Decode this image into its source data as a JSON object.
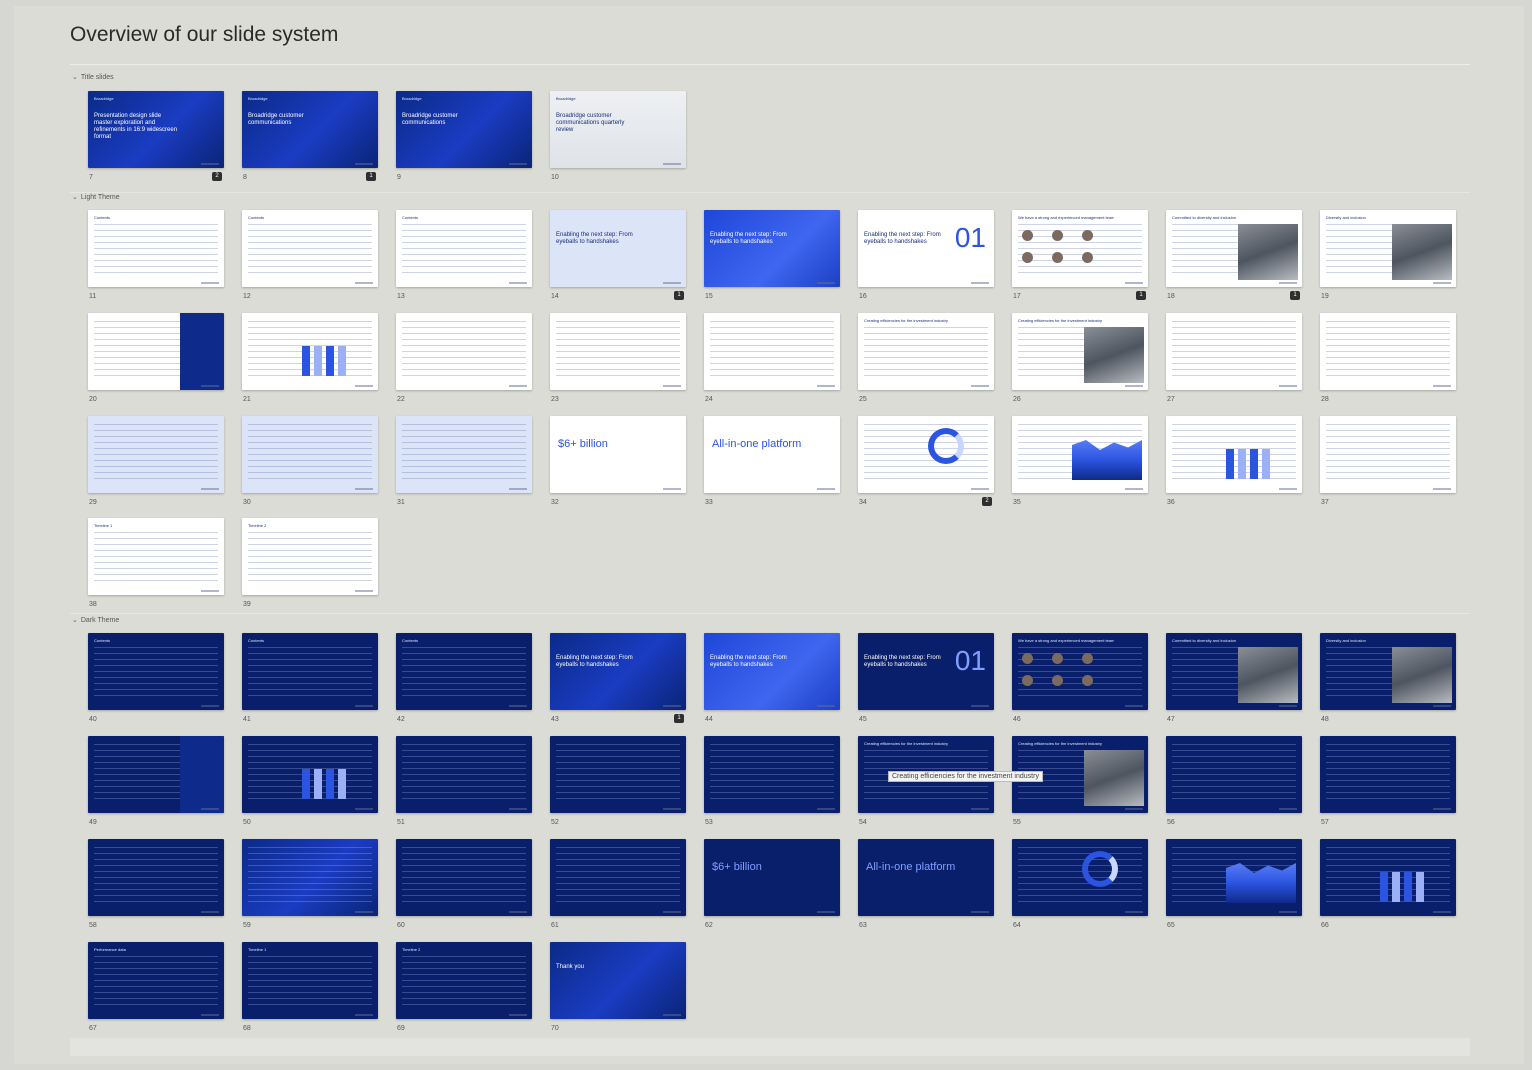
{
  "page": {
    "title": "Overview of our slide system"
  },
  "sections": [
    {
      "label": "Title slides"
    },
    {
      "label": "Light Theme"
    },
    {
      "label": "Dark Theme"
    }
  ],
  "slides": [
    {
      "num": "7",
      "head": "Broadridge",
      "title": "Presentation design slide master exploration and refinements in 16:9 widescreen format",
      "style": "blue",
      "comment": "2"
    },
    {
      "num": "8",
      "head": "Broadridge",
      "title": "Broadridge customer communications",
      "style": "blue",
      "comment": "1"
    },
    {
      "num": "9",
      "head": "Broadridge",
      "title": "Broadridge customer communications",
      "style": "blue"
    },
    {
      "num": "10",
      "head": "Broadridge",
      "title": "Broadridge customer communications quarterly review",
      "style": "photo"
    },
    {
      "num": "11",
      "head": "Contents",
      "style": "light"
    },
    {
      "num": "12",
      "head": "Contents",
      "style": "light"
    },
    {
      "num": "13",
      "head": "Contents",
      "style": "light"
    },
    {
      "num": "14",
      "title": "Enabling the next step: From eyeballs to handshakes",
      "style": "lightblue",
      "comment": "1"
    },
    {
      "num": "15",
      "title": "Enabling the next step: From eyeballs to handshakes",
      "style": "brightblue"
    },
    {
      "num": "16",
      "title": "Enabling the next step: From eyeballs to handshakes",
      "big": "01",
      "style": "light"
    },
    {
      "num": "17",
      "head": "We have a strong and experienced management team",
      "style": "light",
      "comment": "1"
    },
    {
      "num": "18",
      "head": "Committed to diversity and inclusion",
      "style": "light",
      "comment": "1"
    },
    {
      "num": "19",
      "head": "Diversity and inclusion",
      "style": "light"
    },
    {
      "num": "20",
      "style": "light"
    },
    {
      "num": "21",
      "style": "light"
    },
    {
      "num": "22",
      "style": "light"
    },
    {
      "num": "23",
      "style": "light"
    },
    {
      "num": "24",
      "style": "light"
    },
    {
      "num": "25",
      "head": "Creating efficiencies for the investment industry",
      "style": "light"
    },
    {
      "num": "26",
      "head": "Creating efficiencies for the investment industry",
      "style": "light"
    },
    {
      "num": "27",
      "style": "light"
    },
    {
      "num": "28",
      "style": "light"
    },
    {
      "num": "29",
      "style": "lightblue"
    },
    {
      "num": "30",
      "style": "lightblue"
    },
    {
      "num": "31",
      "style": "lightblue"
    },
    {
      "num": "32",
      "big": "$6+ billion",
      "style": "light"
    },
    {
      "num": "33",
      "big": "All-in-one platform",
      "style": "light"
    },
    {
      "num": "34",
      "style": "light",
      "comment": "2"
    },
    {
      "num": "35",
      "style": "light"
    },
    {
      "num": "36",
      "style": "light"
    },
    {
      "num": "37",
      "style": "light"
    },
    {
      "num": "38",
      "head": "Timeline 1",
      "style": "light"
    },
    {
      "num": "39",
      "head": "Timeline 2",
      "style": "light"
    },
    {
      "num": "40",
      "head": "Contents",
      "style": "navy"
    },
    {
      "num": "41",
      "head": "Contents",
      "style": "navy"
    },
    {
      "num": "42",
      "head": "Contents",
      "style": "navy"
    },
    {
      "num": "43",
      "title": "Enabling the next step: From eyeballs to handshakes",
      "style": "blue",
      "comment": "1"
    },
    {
      "num": "44",
      "title": "Enabling the next step: From eyeballs to handshakes",
      "style": "brightblue"
    },
    {
      "num": "45",
      "title": "Enabling the next step: From eyeballs to handshakes",
      "big": "01",
      "style": "navy"
    },
    {
      "num": "46",
      "head": "We have a strong and experienced management team",
      "style": "navy"
    },
    {
      "num": "47",
      "head": "Committed to diversity and inclusion",
      "style": "navy"
    },
    {
      "num": "48",
      "head": "Diversity and inclusion",
      "style": "navy"
    },
    {
      "num": "49",
      "style": "navy"
    },
    {
      "num": "50",
      "style": "navy"
    },
    {
      "num": "51",
      "style": "navy"
    },
    {
      "num": "52",
      "style": "navy"
    },
    {
      "num": "53",
      "style": "navy"
    },
    {
      "num": "54",
      "head": "Creating efficiencies for the investment industry",
      "style": "navy"
    },
    {
      "num": "55",
      "head": "Creating efficiencies for the investment industry",
      "style": "navy"
    },
    {
      "num": "56",
      "style": "navy"
    },
    {
      "num": "57",
      "style": "navy"
    },
    {
      "num": "58",
      "style": "navy"
    },
    {
      "num": "59",
      "style": "blue"
    },
    {
      "num": "60",
      "style": "navy"
    },
    {
      "num": "61",
      "style": "navy"
    },
    {
      "num": "62",
      "big": "$6+ billion",
      "style": "navy"
    },
    {
      "num": "63",
      "big": "All-in-one platform",
      "style": "navy"
    },
    {
      "num": "64",
      "style": "navy"
    },
    {
      "num": "65",
      "style": "navy"
    },
    {
      "num": "66",
      "style": "navy"
    },
    {
      "num": "67",
      "head": "Performance data",
      "style": "navy"
    },
    {
      "num": "68",
      "head": "Timeline 1",
      "style": "navy"
    },
    {
      "num": "69",
      "head": "Timeline 2",
      "style": "navy"
    },
    {
      "num": "70",
      "title": "Thank you",
      "style": "blue"
    }
  ],
  "tooltip": "Creating efficiencies for the investment industry",
  "colors": {
    "accent": "#2b54e0",
    "navy": "#0a1f6b",
    "background": "#d6d6d2"
  }
}
